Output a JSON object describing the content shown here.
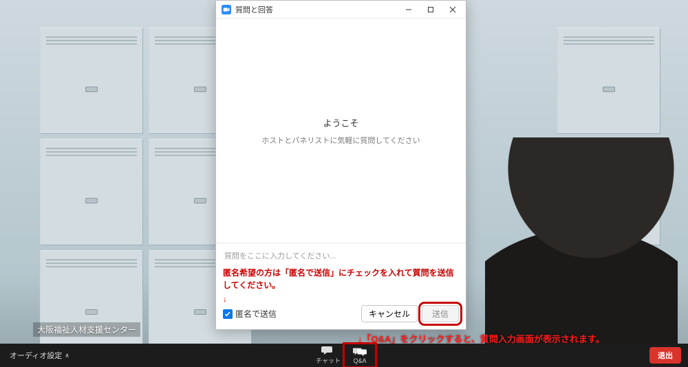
{
  "qa_dialog": {
    "title": "質問と回答",
    "welcome": "ようこそ",
    "welcome_sub": "ホストとパネリストに気軽に質問してください",
    "input_placeholder": "質問をここに入力してください...",
    "anonymous_label": "匿名で送信",
    "cancel_label": "キャンセル",
    "send_label": "送信"
  },
  "annotations": {
    "anon_instruction": "匿名希望の方は「匿名で送信」にチェックを入れて質問を送信してください。",
    "arrow": "↓",
    "qa_click_instruction": "↓「Q&A」をクリックすると、質問入力画面が表示されます。"
  },
  "toolbar": {
    "audio_settings": "オーディオ設定",
    "chat_label": "チャット",
    "qa_label": "Q&A",
    "leave_label": "退出"
  },
  "watermark": "大阪福祉人材支援センター"
}
